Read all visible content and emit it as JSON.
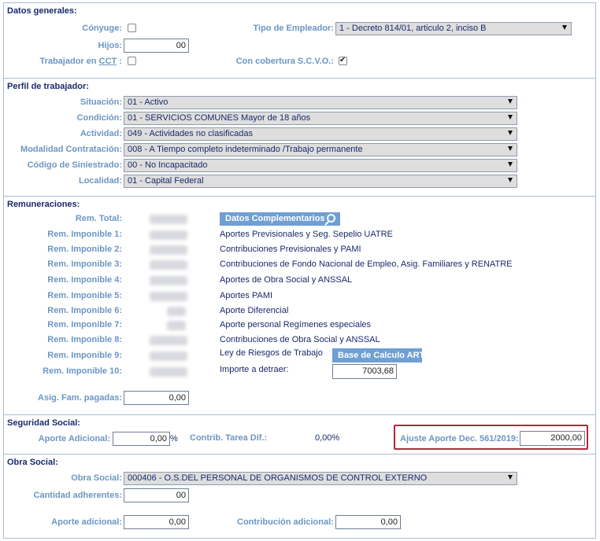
{
  "datos_generales": {
    "title": "Datos generales:",
    "conyuge_label": "Cónyuge:",
    "tipo_empleador_label": "Tipo de Empleador:",
    "tipo_empleador_value": "1 - Decreto 814/01, articulo 2, inciso B",
    "hijos_label": "Hijos:",
    "hijos_value": "00",
    "trabajador_cct_prefix": "Trabajador en ",
    "trabajador_cct_link": "CCT",
    "trabajador_cct_suffix": " :",
    "cobertura_label": "Con cobertura S.C.V.O.:"
  },
  "perfil": {
    "title": "Perfil de trabajador:",
    "fields": [
      {
        "label": "Situación:",
        "value": "01 - Activo"
      },
      {
        "label": "Condición:",
        "value": "01 - SERVICIOS COMUNES Mayor de 18 años"
      },
      {
        "label": "Actividad:",
        "value": "049 - Actividades no clasificadas"
      },
      {
        "label": "Modalidad Contratación:",
        "value": "008 - A Tiempo completo indeterminado /Trabajo permanente"
      },
      {
        "label": "Código de Siniestrado:",
        "value": "00 - No Incapacitado"
      },
      {
        "label": "Localidad:",
        "value": "01 - Capital Federal"
      }
    ]
  },
  "remuneraciones": {
    "title": "Remuneraciones:",
    "rem_total_label": "Rem. Total:",
    "rem_labels": [
      "Rem. Imponible 1:",
      "Rem. Imponible 2:",
      "Rem. Imponible 3:",
      "Rem. Imponible 4:",
      "Rem. Imponible 5:",
      "Rem. Imponible 6:",
      "Rem. Imponible 7:",
      "Rem. Imponible 8:",
      "Rem. Imponible 9:",
      "Rem. Imponible 10:"
    ],
    "datos_complementarios_button": "Datos Complementarios",
    "descriptions": [
      "Aportes Previsionales y Seg. Sepelio UATRE",
      "Contribuciones Previsionales y PAMI",
      "Contribuciones de Fondo Nacional de Empleo, Asig. Familiares y RENATRE",
      "Aportes de Obra Social y ANSSAL",
      "Aportes PAMI",
      "Aporte Diferencial",
      "Aporte personal Regímenes especiales",
      "Contribuciones de Obra Social y ANSSAL",
      "Ley de Riesgos de Trabajo"
    ],
    "base_calculo_button": "Base de Calculo ART",
    "importe_detraer_label": "Importe a detraer:",
    "importe_detraer_value": "7003,68",
    "asig_fam_label": "Asig. Fam. pagadas:",
    "asig_fam_value": "0,00"
  },
  "seguridad_social": {
    "title": "Seguridad Social:",
    "aporte_adicional_label": "Aporte Adicional:",
    "aporte_adicional_value": "0,00",
    "percent": "%",
    "contrib_tarea_label": "Contrib. Tarea Dif.:",
    "contrib_tarea_value": "0,00%",
    "ajuste_label": "Ajuste Aporte Dec. 561/2019:",
    "ajuste_value": "2000,00"
  },
  "obra_social": {
    "title": "Obra Social:",
    "obra_social_label": "Obra Social:",
    "obra_social_value": "000406 - O.S.DEL PERSONAL DE ORGANISMOS DE CONTROL EXTERNO",
    "cantidad_label": "Cantidad adherentes:",
    "cantidad_value": "00",
    "aporte_adicional_label": "Aporte adicional:",
    "aporte_adicional_value": "0,00",
    "contribucion_label": "Contribución adicional:",
    "contribucion_value": "0,00"
  },
  "colors": {
    "border": "#a9bcd6",
    "label": "#6c96c4",
    "text": "#1a2a6c",
    "button": "#6f9fd3",
    "highlight": "#b3293a"
  }
}
